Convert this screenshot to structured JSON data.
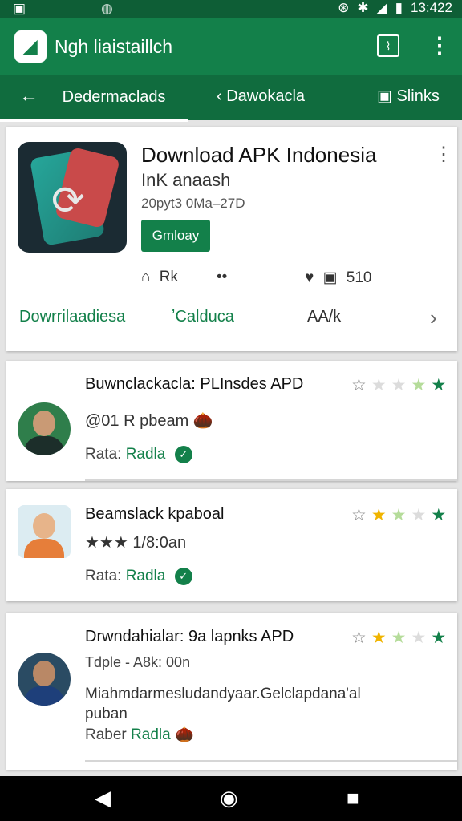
{
  "status_bar": {
    "left_icon": "app-icon",
    "right_text": "13:422"
  },
  "app_bar": {
    "title": "Ngh liaistaillch",
    "actions": [
      "graph-icon",
      "more-vert-icon"
    ]
  },
  "tabs": [
    {
      "label": "Dedermaclads",
      "icon": "arrow-left-icon",
      "active": true
    },
    {
      "label": "Dawokacla",
      "icon": "chevron-left-icon",
      "active": false
    },
    {
      "label": "Slinks",
      "icon": "note-icon",
      "active": false
    }
  ],
  "hero": {
    "title": "Download APK Indonesia",
    "subtitle": "InK anaash",
    "meta": "20pyt3 0Ma–27D",
    "button": "Gmloay",
    "stats": {
      "home": "Rk",
      "dots": "••",
      "value": "510"
    },
    "links": [
      "Dowrrilaadiesa",
      "ʼCalduca",
      "AA/k"
    ]
  },
  "reviews": [
    {
      "name": "Buwnclackacla: PLInsdes APD",
      "line1": "@01 R pbeam",
      "line1_emoji": "🌰",
      "rating_label": "Rata:",
      "rating_value": "Radla",
      "stars": [
        0,
        0,
        0,
        1,
        1
      ]
    },
    {
      "name": "Beamslack kpaboal",
      "line1": "★★★ 1/8:0an",
      "rating_label": "Rata:",
      "rating_value": "Radla",
      "stars": [
        0,
        1,
        1,
        0,
        1
      ]
    },
    {
      "name": "Drwndahialar: 9a lapnks APD",
      "line1": "Tdple - A8k: 00n",
      "line2": "Miahmdarmesludandyaar.Gelclapdana'al",
      "line3": "puban",
      "rating_label": "Raber",
      "rating_value": "Radla",
      "rating_emoji": "🌰",
      "stars": [
        0,
        1,
        1,
        0,
        1
      ]
    }
  ],
  "colors": {
    "primary": "#13804a",
    "primary_dark": "#106c3e",
    "status": "#0e5e36"
  }
}
